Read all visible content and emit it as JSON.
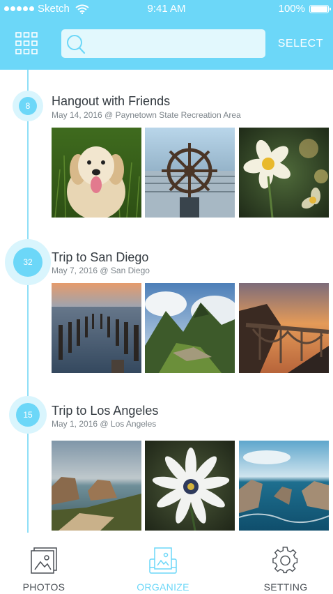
{
  "status_bar": {
    "carrier": "Sketch",
    "time": "9:41 AM",
    "battery": "100%"
  },
  "header": {
    "search": {
      "value": "",
      "placeholder": ""
    },
    "select_label": "SELECT",
    "icons": {
      "left": "grid-icon",
      "search": "search-icon"
    }
  },
  "events": [
    {
      "count": "8",
      "title": "Hangout with Friends",
      "subtitle": "May 14, 2016 @ Paynetown State Recreation Area",
      "photos": [
        "golden-retriever-dog",
        "ship-wheel",
        "yellow-white-daffodils"
      ]
    },
    {
      "count": "32",
      "title": "Trip to San Diego",
      "subtitle": "May 7, 2016 @ San Diego",
      "photos": [
        "pier-pilings-sunset",
        "machu-picchu-mountains",
        "coastal-bridge-sunset"
      ]
    },
    {
      "count": "15",
      "title": "Trip to Los Angeles",
      "subtitle": "May 1, 2016 @ Los Angeles",
      "photos": [
        "sea-cliffs-beach",
        "white-daisy-flower",
        "rocky-coast-ocean"
      ]
    }
  ],
  "tab_bar": {
    "tabs": [
      {
        "label": "PHOTOS",
        "icon": "photos-icon",
        "active": false
      },
      {
        "label": "ORGANIZE",
        "icon": "organize-icon",
        "active": true
      },
      {
        "label": "SETTING",
        "icon": "gear-icon",
        "active": false
      }
    ]
  },
  "colors": {
    "accent": "#6cd7f8",
    "search_bg": "#e2f8fd",
    "text_dark": "#333a40",
    "text_muted": "#7d858b",
    "tab_inactive": "#4a4f55"
  }
}
